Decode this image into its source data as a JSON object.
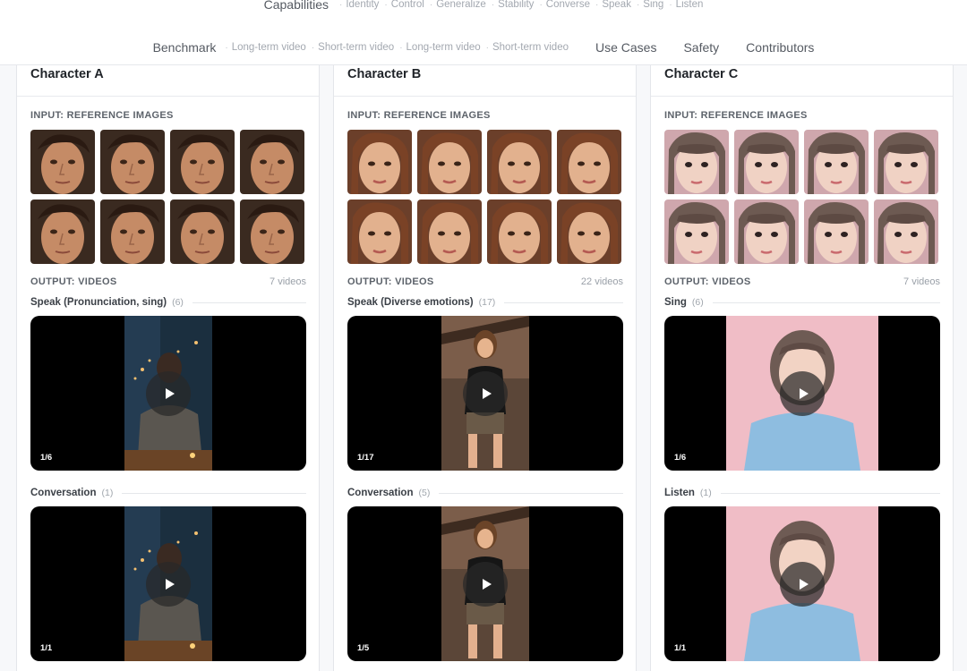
{
  "nav": {
    "row1": {
      "main": "Capabilities",
      "subs": [
        "Identity",
        "Control",
        "Generalize",
        "Stability",
        "Converse",
        "Speak",
        "Sing",
        "Listen"
      ]
    },
    "row2": {
      "benchmark": "Benchmark",
      "subs": [
        "Long-term video",
        "Short-term video",
        "Long-term video",
        "Short-term video"
      ],
      "use_cases": "Use Cases",
      "safety": "Safety",
      "contributors": "Contributors"
    }
  },
  "columns": [
    {
      "title": "Character A",
      "input_label": "INPUT: REFERENCE IMAGES",
      "output_label": "OUTPUT: VIDEOS",
      "output_count": "7 videos",
      "sections": [
        {
          "title": "Speak (Pronunciation, sing)",
          "count": "(6)",
          "position": "1/6"
        },
        {
          "title": "Conversation",
          "count": "(1)",
          "position": "1/1"
        }
      ]
    },
    {
      "title": "Character B",
      "input_label": "INPUT: REFERENCE IMAGES",
      "output_label": "OUTPUT: VIDEOS",
      "output_count": "22 videos",
      "sections": [
        {
          "title": "Speak (Diverse emotions)",
          "count": "(17)",
          "position": "1/17"
        },
        {
          "title": "Conversation",
          "count": "(5)",
          "position": "1/5"
        }
      ]
    },
    {
      "title": "Character C",
      "input_label": "INPUT: REFERENCE IMAGES",
      "output_label": "OUTPUT: VIDEOS",
      "output_count": "7 videos",
      "sections": [
        {
          "title": "Sing",
          "count": "(6)",
          "position": "1/6"
        },
        {
          "title": "Listen",
          "count": "(1)",
          "position": "1/1"
        }
      ]
    }
  ],
  "icons": {
    "play": "play-icon"
  },
  "colors": {
    "video_bg": "#000000",
    "card_bg": "#ffffff",
    "page_bg": "#f7f8fa"
  }
}
